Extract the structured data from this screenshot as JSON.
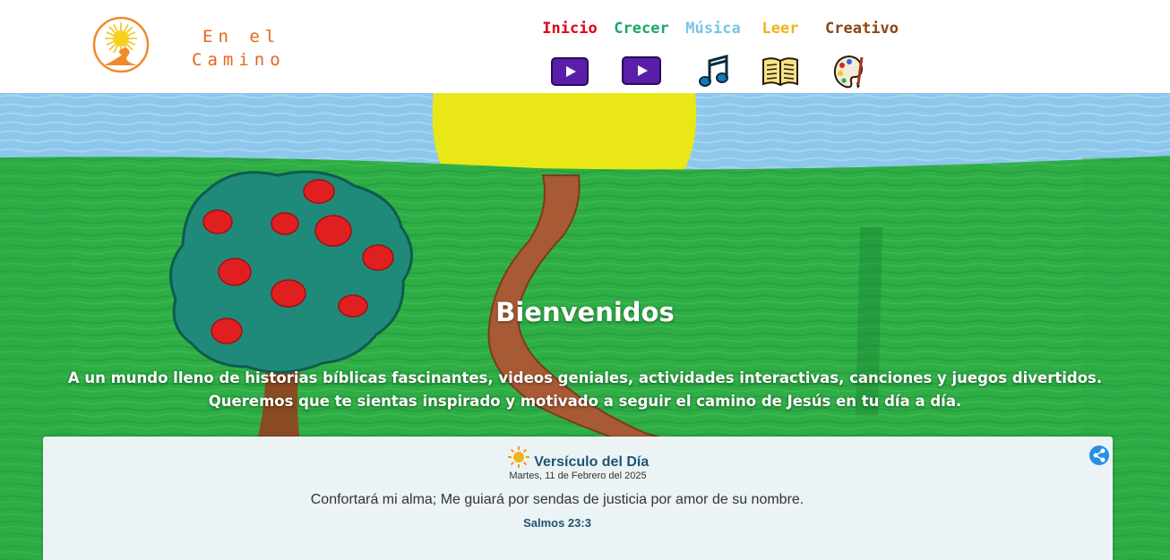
{
  "brand": {
    "line1": "En el",
    "line2": "Camino"
  },
  "nav": [
    {
      "label": "Inicio",
      "color": "#e0001a",
      "icon": "video-play-icon"
    },
    {
      "label": "Crecer",
      "color": "#1aa86a",
      "icon": "video-play-icon"
    },
    {
      "label": "Música",
      "color": "#7bc4e8",
      "icon": "music-note-icon"
    },
    {
      "label": "Leer",
      "color": "#f2b21b",
      "icon": "open-book-icon"
    },
    {
      "label": "Creativo",
      "color": "#8b4513",
      "icon": "paint-palette-icon"
    }
  ],
  "hero": {
    "title": "Bienvenidos",
    "text": "A un mundo lleno de historias bíblicas fascinantes, videos geniales, actividades interactivas, canciones y juegos divertidos. Queremos que te sientas inspirado y motivado a seguir el camino de Jesús en tu día a día."
  },
  "verse": {
    "title": "Versículo del Día",
    "date": "Martes, 11 de Febrero del 2025",
    "text": "Confortará mi alma; Me guiará por sendas de justicia por amor de su nombre.",
    "reference": "Salmos 23:3",
    "share_icon": "share-icon"
  },
  "colors": {
    "brand": "#e8641c",
    "sky": "#8ec7ec",
    "grass": "#2fae46",
    "sun": "#e8e51a",
    "verse_accent": "#1e5472"
  }
}
